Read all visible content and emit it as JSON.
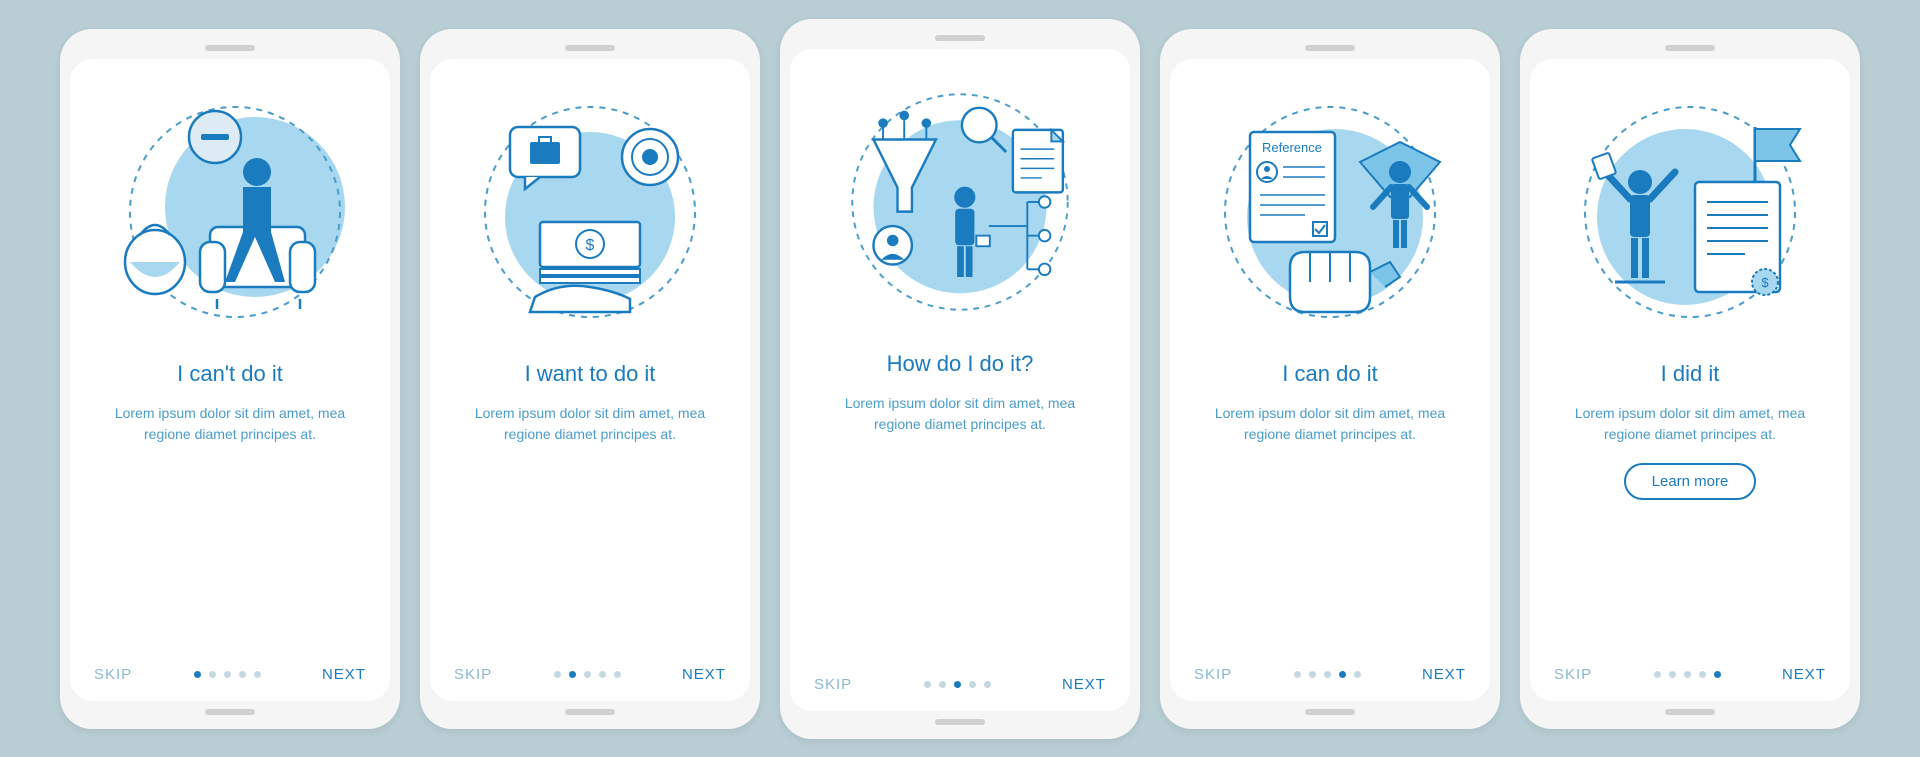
{
  "screens": [
    {
      "title": "I can't do it",
      "desc": "Lorem ipsum dolor sit dim amet, mea regione diamet principes at.",
      "skip": "SKIP",
      "next": "NEXT",
      "activeDot": 0
    },
    {
      "title": "I want to do it",
      "desc": "Lorem ipsum dolor sit dim amet, mea regione diamet principes at.",
      "skip": "SKIP",
      "next": "NEXT",
      "activeDot": 1
    },
    {
      "title": "How do I do it?",
      "desc": "Lorem ipsum dolor sit dim amet, mea regione diamet principes at.",
      "skip": "SKIP",
      "next": "NEXT",
      "activeDot": 2
    },
    {
      "title": "I can do it",
      "desc": "Lorem ipsum dolor sit dim amet, mea regione diamet principes at.",
      "skip": "SKIP",
      "next": "NEXT",
      "activeDot": 3
    },
    {
      "title": "I did it",
      "desc": "Lorem ipsum dolor sit dim amet, mea regione diamet principes at.",
      "skip": "SKIP",
      "next": "NEXT",
      "learnMore": "Learn more",
      "activeDot": 4
    }
  ],
  "referenceLabel": "Reference",
  "colors": {
    "accent": "#1a7bbf",
    "light": "#7dc5e8",
    "fill": "#a8d8ef"
  }
}
